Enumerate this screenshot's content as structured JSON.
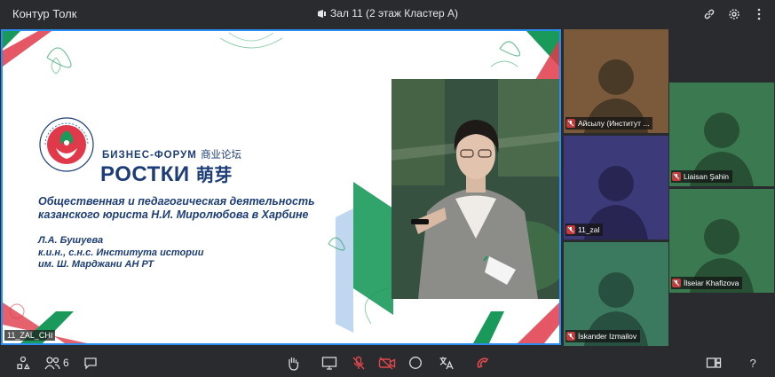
{
  "app": {
    "title": "Контур Толк"
  },
  "room": {
    "title": "Зал 11 (2 этаж Кластер А)"
  },
  "slide": {
    "logo_small_text": "БИЗНЕС-ФОРУМ",
    "logo_small_cn": "商业论坛",
    "logo_big_text": "РОСТКИ",
    "logo_big_cn": "萌芽",
    "logo_ring_text": "РОССИЯ · ТАТАРСТАН · КИТАЙ",
    "title_line1": "Общественная и педагогическая деятельность",
    "title_line2": "казанского юриста Н.И. Миролюбова в Харбине",
    "author_line1": "Л.А. Бушуева",
    "author_line2": "к.и.н., с.н.с. Института истории",
    "author_line3": "им. Ш. Марджани АН РТ"
  },
  "stage_label": "11_ZAL_CHI",
  "participants": [
    {
      "name": "Айсылу (Институт ...",
      "bg": "#7a5a3a",
      "muted": true
    },
    {
      "name": "Liaisan Şahin",
      "bg": "#3b7a50",
      "muted": true
    },
    {
      "name": "11_zal",
      "bg": "#3d3a7a",
      "muted": true
    },
    {
      "name": "İlseiar Khafizova",
      "bg": "#3b7a50",
      "muted": true
    },
    {
      "name": "İskander Izmailov",
      "bg": "#3b7a5e",
      "muted": true
    }
  ],
  "toolbar": {
    "participants_count": "6"
  },
  "colors": {
    "accent": "#2b8df0",
    "danger": "#e0484b",
    "brand_navy": "#1d3d76",
    "brand_green": "#1a9a5a",
    "brand_red": "#e03a4a"
  }
}
